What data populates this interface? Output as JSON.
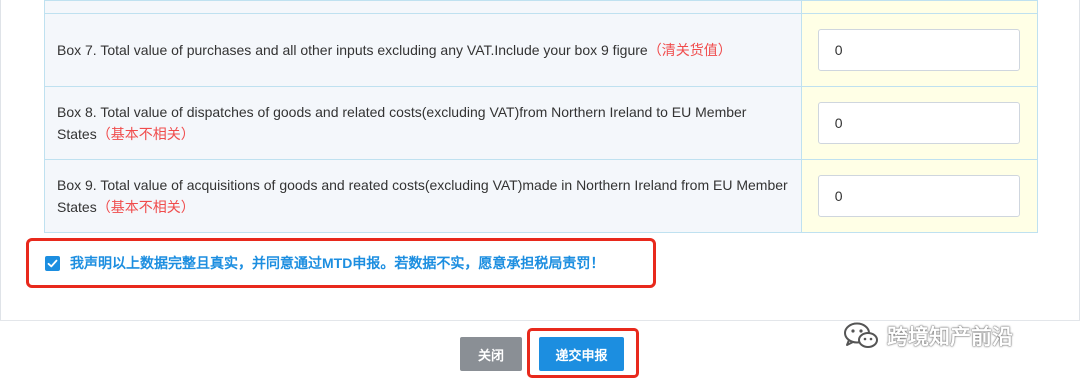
{
  "rows": [
    {
      "label": "Box 7. Total value of purchases and all other inputs excluding any VAT.Include your box 9 figure",
      "note": "（清关货值）",
      "value": "0"
    },
    {
      "label": "Box 8. Total value of dispatches of goods and related costs(excluding VAT)from Northern Ireland to EU Member States",
      "note": "（基本不相关）",
      "value": "0"
    },
    {
      "label": "Box 9. Total value of acquisitions of goods and reated costs(excluding VAT)made in Northern Ireland from EU Member States",
      "note": "（基本不相关）",
      "value": "0"
    }
  ],
  "declaration": {
    "checked": true,
    "text": "我声明以上数据完整且真实，并同意通过MTD申报。若数据不实，愿意承担税局责罚！"
  },
  "buttons": {
    "close_label": "关闭",
    "submit_label": "递交申报"
  },
  "watermark": {
    "text": "跨境知产前沿",
    "icon": "wechat-icon"
  },
  "colors": {
    "accent": "#1c8ee0",
    "highlight_border": "#e8291c",
    "note": "#f04c4c",
    "input_cell_bg": "#ffffe6"
  }
}
